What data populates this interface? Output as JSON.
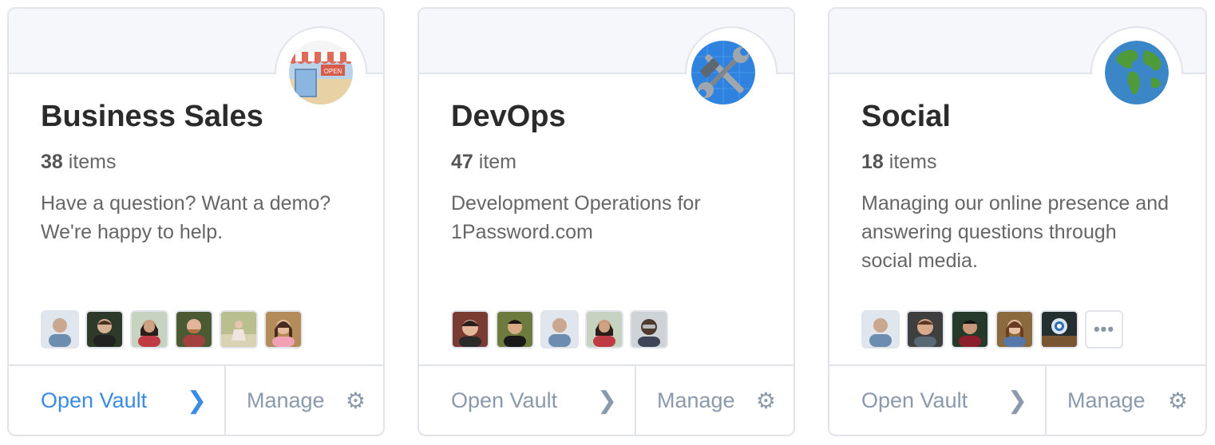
{
  "vaults": [
    {
      "title": "Business Sales",
      "count_number": "38",
      "count_unit": "items",
      "description": "Have a question? Want a demo? We're happy to help.",
      "icon": "storefront-icon",
      "open_label": "Open Vault",
      "manage_label": "Manage",
      "open_active": true,
      "avatar_count": 6
    },
    {
      "title": "DevOps",
      "count_number": "47",
      "count_unit": "item",
      "description": "Development Operations for 1Password.com",
      "icon": "tools-icon",
      "open_label": "Open Vault",
      "manage_label": "Manage",
      "open_active": false,
      "avatar_count": 5
    },
    {
      "title": "Social",
      "count_number": "18",
      "count_unit": "items",
      "description": "Managing our online presence and answering questions through social media.",
      "icon": "globe-icon",
      "open_label": "Open Vault",
      "manage_label": "Manage",
      "open_active": false,
      "avatar_count": 5,
      "more_label": "•••"
    }
  ],
  "colors": {
    "accent": "#3a8be6",
    "muted": "#8a99ac",
    "border": "#e1e4ea",
    "header_bg": "#f6f7fa"
  }
}
